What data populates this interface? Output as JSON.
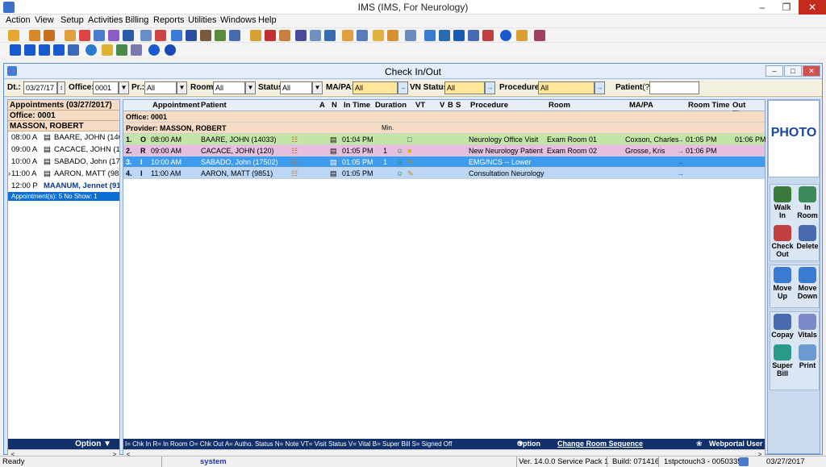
{
  "window": {
    "title": "IMS (IMS, For Neurology)"
  },
  "menu": [
    "Action",
    "View",
    "Setup",
    "Activities",
    "Billing",
    "Reports",
    "Utilities",
    "Windows",
    "Help"
  ],
  "child_window": {
    "title": "Check In/Out"
  },
  "filters": {
    "dt_label": "Dt.:",
    "dt_value": "03/27/17",
    "office_label": "Office:",
    "office_value": "0001",
    "pr_label": "Pr.:",
    "pr_value": "All",
    "room_label": "Room:",
    "room_value": "All",
    "status_label": "Status:",
    "status_value": "All",
    "mapa_label": "MA/PA:",
    "mapa_value": "All",
    "vn_label": "VN Status:",
    "vn_value": "All",
    "proc_label": "Procedure:",
    "proc_value": "All",
    "patient_label": "Patient",
    "patient_hint": "(?)"
  },
  "left_panel": {
    "header": "Appointments (03/27/2017)",
    "office": "Office: 0001",
    "provider": "MASSON, ROBERT",
    "appointments": [
      {
        "time": "08:00 A",
        "name": "BAARE, JOHN (14033"
      },
      {
        "time": "09:00 A",
        "name": "CACACE, JOHN (120"
      },
      {
        "time": "10:00 A",
        "name": "SABADO, John (1750"
      },
      {
        "time": "11:00 A",
        "name": "AARON, MATT (9851"
      },
      {
        "time": "12:00 P",
        "name": "MAANUM, Jennet (91"
      }
    ],
    "summary": "Appointment(s): 5    No Show: 1",
    "footer": "Option"
  },
  "table": {
    "headers": [
      "Appointment",
      "Patient",
      "A",
      "N",
      "In Time",
      "Duration",
      "VT",
      "V",
      "B",
      "S",
      "Procedure",
      "Room",
      "MA/PA",
      "Room Time",
      "Out Time"
    ],
    "office_row": "Office: 0001",
    "provider_row": "Provider: MASSON, ROBERT",
    "min_label": "Min.",
    "rows": [
      {
        "no": "1.",
        "st": "O",
        "time": "08:00 AM",
        "patient": "BAARE, JOHN (14033)",
        "in": "01:04 PM",
        "dur": "",
        "proc": "Neurology Office Visit",
        "room": "Exam Room 01",
        "mapa": "Coxson, Charles",
        "rtime": "01:05 PM",
        "out": "01:06 PM",
        "bg": "#c3e6a8"
      },
      {
        "no": "2.",
        "st": "R",
        "time": "09:00 AM",
        "patient": "CACACE, JOHN (120)",
        "in": "01:05 PM",
        "dur": "1",
        "proc": "New Neurology Patient",
        "room": "Exam Room 02",
        "mapa": "Grosse, Kris",
        "rtime": "01:06 PM",
        "out": "",
        "bg": "#e6bfe0"
      },
      {
        "no": "3.",
        "st": "I",
        "time": "10:00 AM",
        "patient": "SABADO, John (17502)",
        "in": "01:05 PM",
        "dur": "1",
        "proc": "EMG/NCS -- Lower",
        "room": "",
        "mapa": "",
        "rtime": "",
        "out": "",
        "bg": "#3d9bf0"
      },
      {
        "no": "4.",
        "st": "I",
        "time": "11:00 AM",
        "patient": "AARON, MATT (9851)",
        "in": "01:05 PM",
        "dur": "",
        "proc": "Consultation Neurology",
        "room": "",
        "mapa": "",
        "rtime": "",
        "out": "",
        "bg": "#bcd6f5"
      }
    ],
    "legend": "I= Chk In  R= In Room O= Chk Out  A= Autho. Status  N= Note  VT= Visit Status  V= Vital  B= Super Bill  S= Signed Off",
    "option": "Option",
    "change_room": "Change Room Sequence",
    "webportal": "Webportal User"
  },
  "side_panel": {
    "photo": "PHOTO",
    "buttons": [
      {
        "l1": "Walk",
        "l2": "In"
      },
      {
        "l1": "In",
        "l2": "Room"
      },
      {
        "l1": "Check",
        "l2": "Out"
      },
      {
        "l1": "Delete",
        "l2": ""
      },
      {
        "l1": "Move",
        "l2": "Up"
      },
      {
        "l1": "Move",
        "l2": "Down"
      },
      {
        "l1": "Copay",
        "l2": ""
      },
      {
        "l1": "Vitals",
        "l2": ""
      },
      {
        "l1": "Super",
        "l2": "Bill"
      },
      {
        "l1": "Print",
        "l2": ""
      }
    ]
  },
  "status_bar": {
    "ready": "Ready",
    "user": "system",
    "version": "Ver. 14.0.0 Service Pack 1",
    "build": "Build: 071416",
    "host": "1stpctouch3 - 0050335",
    "date": "03/27/2017"
  }
}
